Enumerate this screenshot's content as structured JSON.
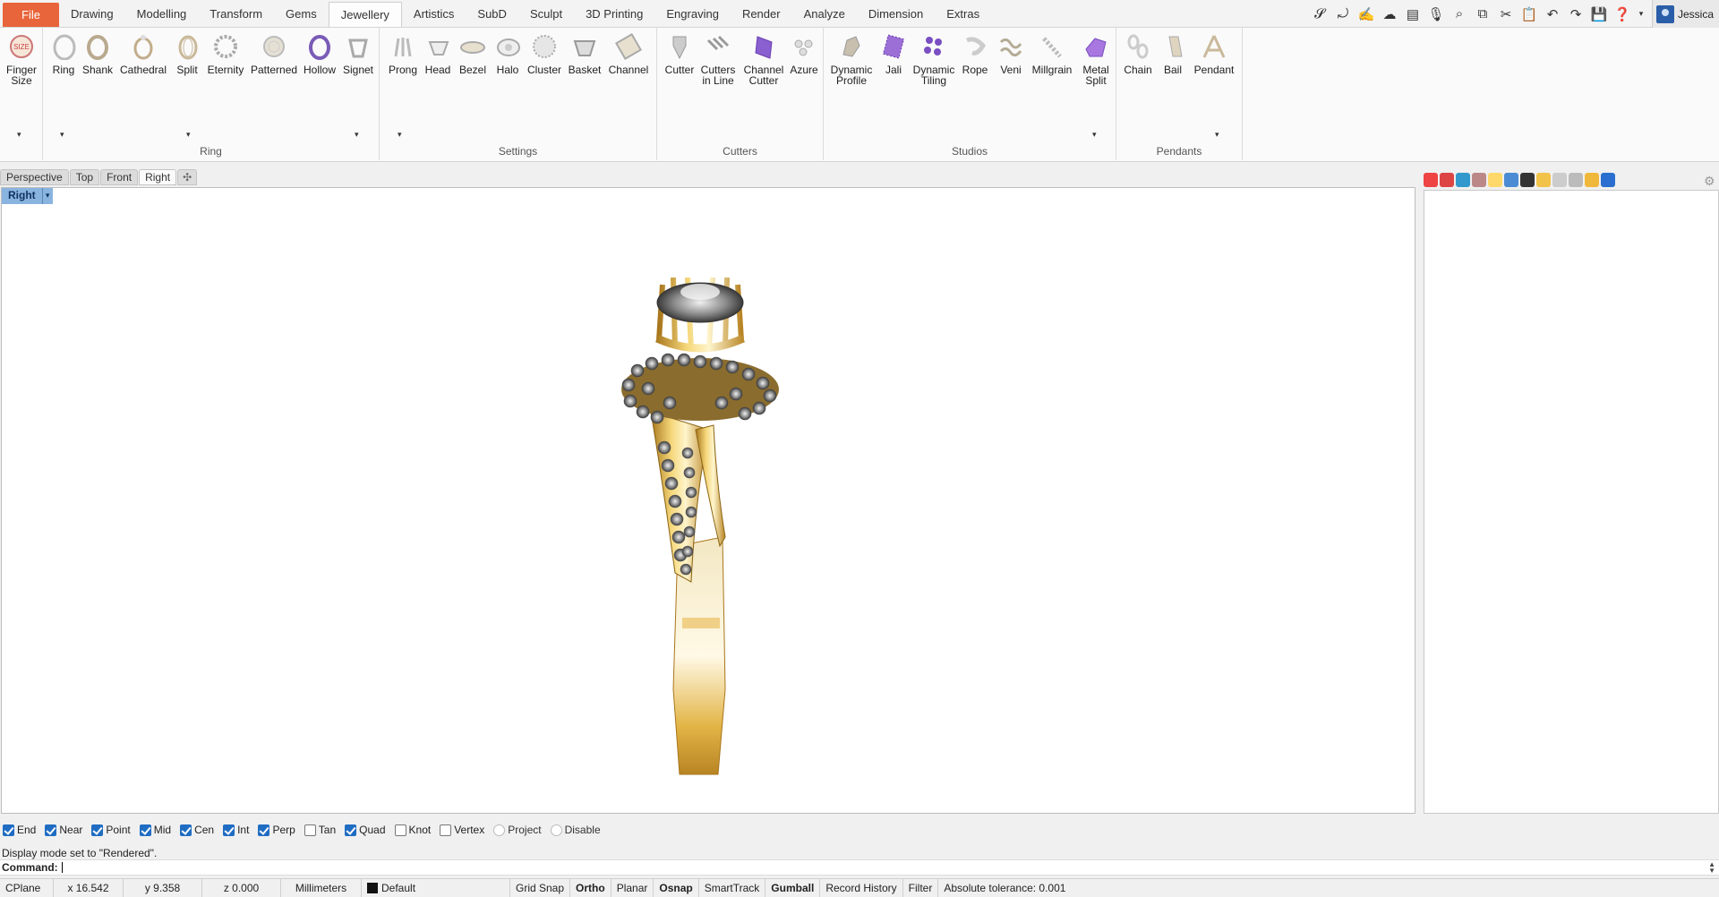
{
  "menu": {
    "tabs": [
      "File",
      "Drawing",
      "Modelling",
      "Transform",
      "Gems",
      "Jewellery",
      "Artistics",
      "SubD",
      "Sculpt",
      "3D Printing",
      "Engraving",
      "Render",
      "Analyze",
      "Dimension",
      "Extras"
    ],
    "active": "Jewellery"
  },
  "user": {
    "name": "Jessica"
  },
  "quick_icons": [
    "clayoo-icon",
    "curve-icon",
    "sculpt-icon",
    "cloud-icon",
    "clapper-icon",
    "microphone-icon",
    "zoom-icon",
    "copy-icon",
    "cut-icon",
    "paste-icon",
    "undo-icon",
    "redo-icon",
    "save-icon",
    "help-icon"
  ],
  "ribbon": {
    "groups": {
      "ring": {
        "label": "Ring",
        "buttons": [
          {
            "label": "Finger\nSize",
            "icon": "finger-size-icon"
          },
          {
            "label": "Ring",
            "icon": "ring-icon"
          },
          {
            "label": "Shank",
            "icon": "shank-icon"
          },
          {
            "label": "Cathedral",
            "icon": "cathedral-icon"
          },
          {
            "label": "Split",
            "icon": "split-icon"
          },
          {
            "label": "Eternity",
            "icon": "eternity-icon"
          },
          {
            "label": "Patterned",
            "icon": "patterned-icon"
          },
          {
            "label": "Hollow",
            "icon": "hollow-icon"
          },
          {
            "label": "Signet",
            "icon": "signet-icon"
          }
        ]
      },
      "settings": {
        "label": "Settings",
        "buttons": [
          {
            "label": "Prong"
          },
          {
            "label": "Head"
          },
          {
            "label": "Bezel"
          },
          {
            "label": "Halo"
          },
          {
            "label": "Cluster"
          },
          {
            "label": "Basket"
          },
          {
            "label": "Channel"
          }
        ]
      },
      "cutters": {
        "label": "Cutters",
        "buttons": [
          {
            "label": "Cutter"
          },
          {
            "label": "Cutters\nin Line"
          },
          {
            "label": "Channel\nCutter"
          },
          {
            "label": "Azure"
          }
        ]
      },
      "studios": {
        "label": "Studios",
        "buttons": [
          {
            "label": "Dynamic\nProfile"
          },
          {
            "label": "Jali"
          },
          {
            "label": "Dynamic\nTiling"
          },
          {
            "label": "Rope"
          },
          {
            "label": "Veni"
          },
          {
            "label": "Millgrain"
          },
          {
            "label": "Metal\nSplit"
          }
        ]
      },
      "pendants": {
        "label": "Pendants",
        "buttons": [
          {
            "label": "Chain"
          },
          {
            "label": "Bail"
          },
          {
            "label": "Pendant"
          }
        ]
      }
    }
  },
  "viewport_tabs": [
    "Perspective",
    "Top",
    "Front",
    "Right"
  ],
  "active_viewport": "Right",
  "viewport_label": "Right",
  "osnap": [
    {
      "label": "End",
      "checked": true
    },
    {
      "label": "Near",
      "checked": true
    },
    {
      "label": "Point",
      "checked": true
    },
    {
      "label": "Mid",
      "checked": true
    },
    {
      "label": "Cen",
      "checked": true
    },
    {
      "label": "Int",
      "checked": true
    },
    {
      "label": "Perp",
      "checked": true
    },
    {
      "label": "Tan",
      "checked": false
    },
    {
      "label": "Quad",
      "checked": true
    },
    {
      "label": "Knot",
      "checked": false
    },
    {
      "label": "Vertex",
      "checked": false
    },
    {
      "label": "Project",
      "checked": false
    },
    {
      "label": "Disable",
      "checked": false
    }
  ],
  "command": {
    "history": "Display mode set to \"Rendered\".",
    "prompt": "Command:"
  },
  "status": {
    "cplane": "CPlane",
    "x": "x 16.542",
    "y": "y 9.358",
    "z": "z 0.000",
    "units": "Millimeters",
    "layer": "Default",
    "grid_snap": "Grid Snap",
    "ortho": "Ortho",
    "planar": "Planar",
    "osnap": "Osnap",
    "smarttrack": "SmartTrack",
    "gumball": "Gumball",
    "record_history": "Record History",
    "filter": "Filter",
    "tolerance": "Absolute tolerance: 0.001"
  },
  "colors": {
    "file_tab": "#e8643a",
    "viewport_label": "#8ab4e0",
    "gold": "#d9a83a",
    "checkbox": "#1f6cc3"
  }
}
